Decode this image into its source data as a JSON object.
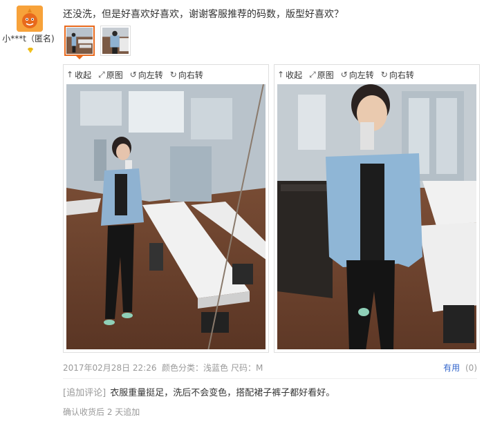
{
  "user": {
    "name": "小***t（匿名)",
    "avatar_icon": "cartoon-face-icon",
    "level_icon": "diamond-icon",
    "avatar_color": "#f7a23a"
  },
  "review": {
    "text": "还没洗，但是好喜欢好喜欢，谢谢客服推荐的码数，版型好喜欢？"
  },
  "thumbnails": [
    {
      "label": "photo-1",
      "selected": true
    },
    {
      "label": "photo-2",
      "selected": false
    }
  ],
  "viewer_toolbar": {
    "collapse": "收起",
    "original": "原图",
    "rotate_left": "向左转",
    "rotate_right": "向右转",
    "collapse_icon": "↑",
    "original_icon": "⤢",
    "rotate_left_icon": "↺",
    "rotate_right_icon": "↻"
  },
  "meta": {
    "date": "2017年02月28日 22:26",
    "color_label": "颜色分类：浅蓝色",
    "size_label": "尺码：M"
  },
  "useful": {
    "label": "有用",
    "count": "(0)",
    "accent": "#3366cc"
  },
  "followup": {
    "tag": "[追加评论]",
    "text": "衣服重量挺足，洗后不会变色，搭配裙子裤子都好看好。",
    "time": "确认收货后 2 天追加"
  },
  "colors": {
    "selected_border": "#e8691c",
    "muted_text": "#999999"
  }
}
